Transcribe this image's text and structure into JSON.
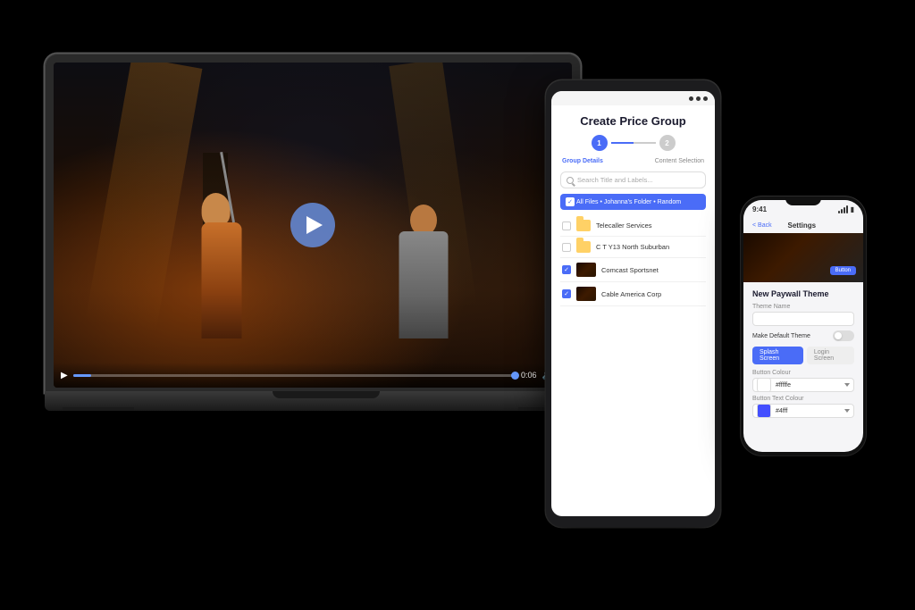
{
  "laptop": {
    "video": {
      "time_current": "0:06",
      "time_total": "0:06"
    }
  },
  "tablet": {
    "title": "Create Price Group",
    "step1_label": "Group Details",
    "step2_label": "Content Selection",
    "search_placeholder": "Search Title and Labels...",
    "breadcrumb": "All Files • Johanna's Folder • Random",
    "files": [
      {
        "name": "Telecaller Services",
        "type": "folder",
        "checked": false
      },
      {
        "name": "C T Y13 North Suburban",
        "type": "folder",
        "checked": false
      },
      {
        "name": "Comcast Sportsnet",
        "type": "video",
        "checked": true
      },
      {
        "name": "Cable America Corp",
        "type": "video",
        "checked": true
      }
    ]
  },
  "phone": {
    "time": "9:41",
    "header_back": "< Back",
    "header_title": "Settings",
    "section_title": "New Paywall Theme",
    "theme_name_label": "Theme Name",
    "theme_name_value": "",
    "make_default_label": "Make Default Theme",
    "splash_tab": "Splash Screen",
    "login_tab": "Login Screen",
    "button_color_label": "Button Colour",
    "button_color_value": "#fffffe",
    "button_text_color_label": "Button Text Colour",
    "button_text_color_value": "#4fff",
    "video_button_label": "Button"
  }
}
